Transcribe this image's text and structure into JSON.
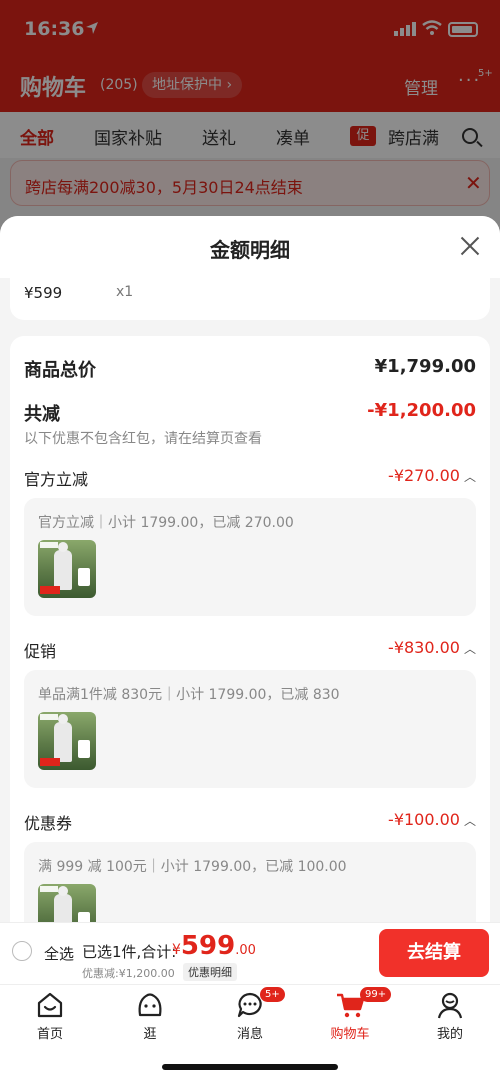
{
  "status_bar": {
    "time": "16:36"
  },
  "background": {
    "cart_title": "购物车",
    "cart_count": "(205)",
    "address_pill": "地址保护中 ›",
    "manage_label": "管理",
    "more_badge": "5+",
    "tabs": [
      {
        "label": "全部",
        "active": true
      },
      {
        "label": "国家补贴",
        "active": false
      },
      {
        "label": "送礼",
        "active": false
      },
      {
        "label": "凑单",
        "active": false
      },
      {
        "label": "跨店满",
        "active": false
      }
    ],
    "promo_tag": "促",
    "promo_banner": "跨店每满200减30，5月30日24点结束"
  },
  "sheet": {
    "title": "金额明细",
    "top_item": {
      "price": "¥599",
      "qty": "x1"
    },
    "total_label": "商品总价",
    "total_value": "¥1,799.00",
    "reduce_label": "共减",
    "reduce_value": "-¥1,200.00",
    "reduce_note": "以下优惠不包含红包，请在结算页查看",
    "sections": [
      {
        "label": "官方立减",
        "value": "-¥270.00",
        "detail": "官方立减｜小计 1799.00，已减 270.00"
      },
      {
        "label": "促销",
        "value": "-¥830.00",
        "detail": "单品满1件减 830元｜小计 1799.00，已减 830"
      },
      {
        "label": "优惠券",
        "value": "-¥100.00",
        "detail": "满 999 减 100元｜小计 1799.00，已减 100.00"
      }
    ]
  },
  "checkout": {
    "select_all": "全选",
    "selected_info": "已选1件,合计:",
    "currency": "¥",
    "price_int": "599",
    "price_dec": ".00",
    "saved": "优惠减:¥1,200.00",
    "detail_chip": "优惠明细",
    "button": "去结算"
  },
  "bottom_nav": [
    {
      "label": "首页",
      "icon": "home-icon"
    },
    {
      "label": "逛",
      "icon": "browse-icon"
    },
    {
      "label": "消息",
      "icon": "message-icon",
      "badge": "5+"
    },
    {
      "label": "购物车",
      "icon": "cart-icon",
      "badge": "99+",
      "active": true
    },
    {
      "label": "我的",
      "icon": "profile-icon"
    }
  ],
  "colors": {
    "accent": "#e0251b",
    "button": "#f1312a"
  }
}
